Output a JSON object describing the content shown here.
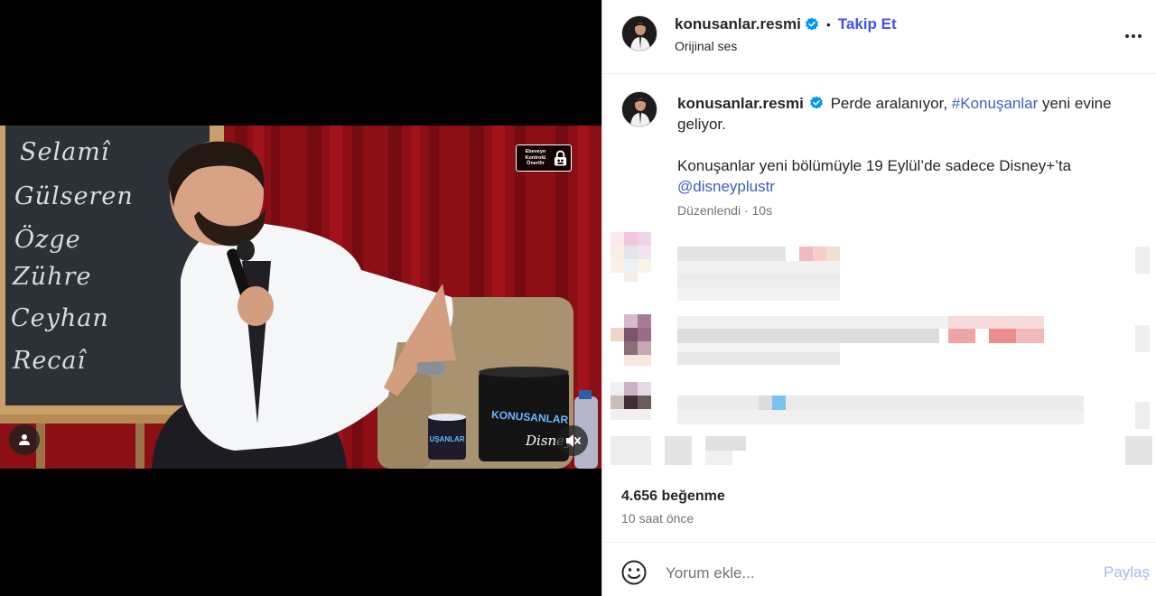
{
  "media": {
    "chalkboard_names": [
      "Selamî",
      "Gülseren",
      "Özge",
      "Zühre",
      "Ceyhan",
      "Recaî"
    ],
    "parental_badge_text": [
      "Ebeveyn",
      "Kontrolü",
      "Önerilir"
    ],
    "cup_text": "UŞANLAR",
    "bin_text": "KONUSANLAR",
    "watermark": "Disney+",
    "icons": {
      "tag": "person-tag-icon",
      "mute": "speaker-muted-icon",
      "lock": "padlock-icon"
    }
  },
  "header": {
    "username": "konusanlar.resmi",
    "separator": "•",
    "follow_label": "Takip Et",
    "audio_label": "Orijinal ses",
    "verified_icon": "verified-badge-icon",
    "more_icon": "more-options-icon"
  },
  "caption": {
    "username": "konusanlar.resmi",
    "text_before_hashtag": "Perde aralanıyor, ",
    "hashtag": "#Konuşanlar",
    "text_after_hashtag": " yeni evine geliyor.",
    "line2": "Konuşanlar yeni bölümüyle 19 Eylül’de sadece Disney+’ta",
    "mention": "@disneyplustr",
    "edited_label": "Düzenlendi",
    "meta_separator": "·",
    "age": "10s"
  },
  "stats": {
    "likes": "4.656 beğenme",
    "time_ago": "10 saat önce"
  },
  "comment_bar": {
    "placeholder": "Yorum ekle...",
    "share_label": "Paylaş",
    "emoji_icon": "smiley-face-icon"
  },
  "colors": {
    "accent_link": "#4150f7",
    "hashtag": "#3d5ec8",
    "verified": "#0095f6",
    "share_disabled": "#a8b8f3",
    "muted_text": "#737373"
  }
}
